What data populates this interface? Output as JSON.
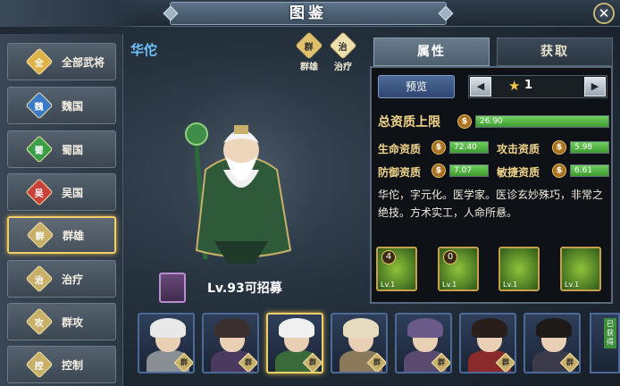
{
  "header": {
    "title": "图鉴",
    "close_label": "✕"
  },
  "sidebar": {
    "items": [
      {
        "label": "全部武将",
        "icon_text": "全",
        "icon_color": "#e0b24a",
        "active": false
      },
      {
        "label": "魏国",
        "icon_text": "魏",
        "icon_color": "#3a78c8",
        "active": false
      },
      {
        "label": "蜀国",
        "icon_text": "蜀",
        "icon_color": "#3a9e48",
        "active": false
      },
      {
        "label": "吴国",
        "icon_text": "吴",
        "icon_color": "#c8423a",
        "active": false
      },
      {
        "label": "群雄",
        "icon_text": "群",
        "icon_color": "#c9b06a",
        "active": true
      },
      {
        "label": "治疗",
        "icon_text": "治",
        "icon_color": "#c9b06a",
        "active": false
      },
      {
        "label": "群攻",
        "icon_text": "攻",
        "icon_color": "#c9b06a",
        "active": false
      },
      {
        "label": "控制",
        "icon_text": "控",
        "icon_color": "#c9b06a",
        "active": false
      }
    ]
  },
  "hero": {
    "name": "华佗",
    "faction_badge": {
      "icon_text": "群",
      "label": "群雄",
      "color": "#e0c06a"
    },
    "role_badge": {
      "icon_text": "治",
      "label": "治疗",
      "color": "#f0e0b0"
    },
    "level_text": "Lv.93可招募"
  },
  "tabs": {
    "attributes": "属性",
    "obtain": "获取"
  },
  "panel": {
    "preview_label": "预览",
    "star_value": "1",
    "total_label": "总资质上限",
    "total_value": "26.90",
    "total_fraction": 1.0,
    "stats": [
      {
        "label": "生命资质",
        "value": "72.40",
        "fraction": 1.0
      },
      {
        "label": "攻击资质",
        "value": "5.98",
        "fraction": 1.0
      },
      {
        "label": "防御资质",
        "value": "7.07",
        "fraction": 1.0
      },
      {
        "label": "敏捷资质",
        "value": "6.61",
        "fraction": 1.0
      }
    ],
    "bio": "华佗，字元化。医学家。医诊玄妙殊巧，非常之绝技。方术实工，人命所悬。",
    "skills": [
      {
        "num": "4",
        "lv": "Lv.1"
      },
      {
        "num": "0",
        "lv": "Lv.1"
      },
      {
        "num": "",
        "lv": "Lv.1"
      },
      {
        "num": "",
        "lv": "Lv.1"
      }
    ]
  },
  "roster": {
    "owned_tag": "已获得",
    "portraits": [
      {
        "faction": "群",
        "hair": "#e8e8e8",
        "body": "#8a8f96",
        "selected": false
      },
      {
        "faction": "群",
        "hair": "#3b3030",
        "body": "#4a3a60",
        "selected": false
      },
      {
        "faction": "群",
        "hair": "#f0f0f0",
        "body": "#3a6a3a",
        "selected": true
      },
      {
        "faction": "群",
        "hair": "#e8dcc0",
        "body": "#8a7a5a",
        "selected": false
      },
      {
        "faction": "群",
        "hair": "#6a5a8a",
        "body": "#5a4a70",
        "selected": false
      },
      {
        "faction": "群",
        "hair": "#2a1e1a",
        "body": "#8a2a2a",
        "selected": false
      },
      {
        "faction": "群",
        "hair": "#1e1a1a",
        "body": "#3a3a4a",
        "selected": false
      }
    ]
  }
}
